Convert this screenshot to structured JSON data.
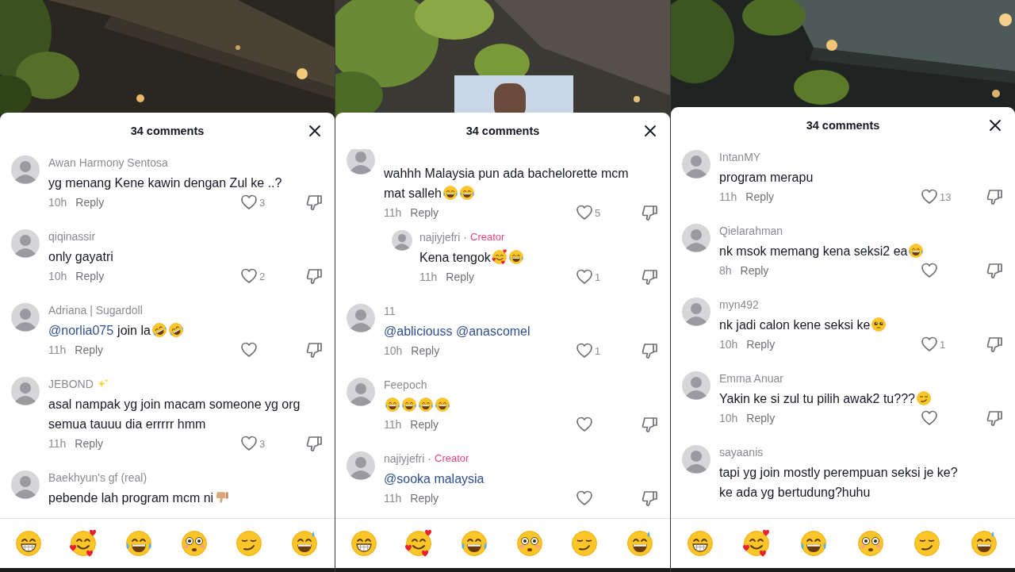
{
  "panels": [
    {
      "backdrop": {
        "kind": "picture"
      },
      "header": {
        "title": "34 comments"
      },
      "comments": [
        {
          "user": "Awan Harmony Sentosa",
          "text": "yg menang Kene kawin dengan Zul ke ..?",
          "time": "10h",
          "reply_label": "Reply",
          "likes": "3"
        },
        {
          "user": "qiqinassir",
          "text": "only gayatri",
          "time": "10h",
          "reply_label": "Reply",
          "likes": "2"
        },
        {
          "user": "Adriana | Sugardoll",
          "mention": "@norlia075",
          "text": "join la",
          "emoji": [
            {
              "kind": "rofl"
            },
            {
              "kind": "rofl"
            }
          ],
          "time": "11h",
          "reply_label": "Reply"
        },
        {
          "user": "JEBOND",
          "user_emoji": [
            {
              "kind": "sparkles"
            }
          ],
          "text": "asal nampak yg join macam someone yg org\nsemua tauuu dia errrrr hmm",
          "time": "11h",
          "reply_label": "Reply",
          "likes": "3"
        },
        {
          "user": "Baekhyun's gf (real)",
          "text": "pebende lah program mcm ni",
          "emoji": [
            {
              "kind": "thumbsdown"
            }
          ]
        }
      ],
      "emoji_bar": [
        {
          "kind": "grin"
        },
        {
          "kind": "hearts"
        },
        {
          "kind": "joy"
        },
        {
          "kind": "flushed"
        },
        {
          "kind": "smirk"
        },
        {
          "kind": "sweat"
        }
      ]
    },
    {
      "backdrop": {
        "kind": "picture"
      },
      "header": {
        "title": "34 comments"
      },
      "comments": [
        {
          "clipped": true,
          "text": "wahhh Malaysia pun ada bachelorette mcm\nmat salleh",
          "emoji": [
            {
              "kind": "joy"
            },
            {
              "kind": "joy"
            }
          ],
          "time": "11h",
          "reply_label": "Reply",
          "likes": "5",
          "replies": [
            {
              "user": "najiyjefri",
              "badge": {
                "separator": "·",
                "label": "Creator"
              },
              "text": "Kena tengok",
              "emoji": [
                {
                  "kind": "hearts"
                },
                {
                  "kind": "joy"
                }
              ],
              "time": "11h",
              "reply_label": "Reply",
              "likes": "1"
            }
          ]
        },
        {
          "user": "11",
          "mention": "@abliciouss @anascomel",
          "time": "10h",
          "reply_label": "Reply",
          "likes": "1"
        },
        {
          "user": "Feepoch",
          "emoji": [
            {
              "kind": "joy"
            },
            {
              "kind": "joy"
            },
            {
              "kind": "joy"
            },
            {
              "kind": "joy"
            }
          ],
          "time": "11h",
          "reply_label": "Reply"
        },
        {
          "user": "najiyjefri",
          "badge": {
            "separator": "·",
            "label": "Creator"
          },
          "mention": "@sooka malaysia",
          "time": "11h",
          "reply_label": "Reply"
        }
      ],
      "emoji_bar": [
        {
          "kind": "grin"
        },
        {
          "kind": "hearts"
        },
        {
          "kind": "joy"
        },
        {
          "kind": "flushed"
        },
        {
          "kind": "smirk"
        },
        {
          "kind": "sweat"
        }
      ]
    },
    {
      "backdrop": {
        "kind": "picture"
      },
      "header": {
        "title": "34 comments"
      },
      "comments": [
        {
          "user": "IntanMY",
          "text": "program merapu",
          "time": "11h",
          "reply_label": "Reply",
          "likes": "13"
        },
        {
          "user": "Qielarahman",
          "text": "nk msok memang kena seksi2 ea",
          "emoji": [
            {
              "kind": "joy"
            }
          ],
          "time": "8h",
          "reply_label": "Reply"
        },
        {
          "user": "myn492",
          "text": "nk jadi calon kene seksi ke",
          "emoji": [
            {
              "kind": "pleading"
            }
          ],
          "time": "10h",
          "reply_label": "Reply",
          "likes": "1"
        },
        {
          "user": "Emma Anuar",
          "text": "Yakin ke si zul tu pilih awak2 tu???",
          "emoji": [
            {
              "kind": "smirk"
            }
          ],
          "time": "10h",
          "reply_label": "Reply"
        },
        {
          "user": "sayaanis",
          "text": "tapi yg join mostly perempuan seksi je ke?\nke ada yg bertudung?huhu"
        }
      ],
      "emoji_bar": [
        {
          "kind": "grin"
        },
        {
          "kind": "hearts"
        },
        {
          "kind": "joy"
        },
        {
          "kind": "flushed"
        },
        {
          "kind": "smirk"
        },
        {
          "kind": "sweat"
        }
      ]
    }
  ]
}
